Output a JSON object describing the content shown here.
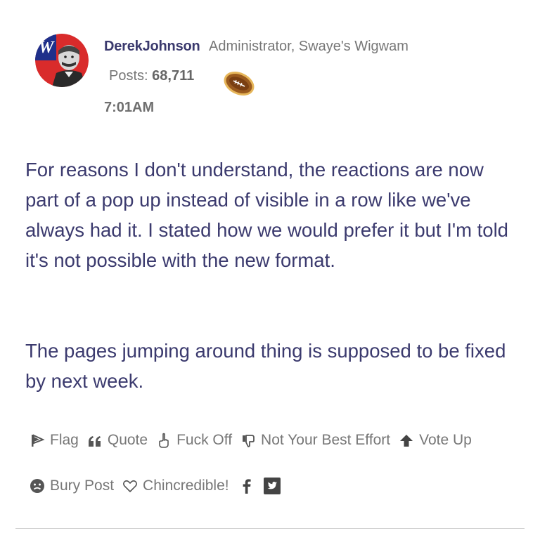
{
  "post": {
    "author": {
      "name": "DerekJohnson",
      "title": "Administrator, Swaye's Wigwam",
      "avatar_icon": "avatar-photo",
      "avatar_logo_letter": "W",
      "posts_label": "Posts:",
      "posts_count": "68,711",
      "rank_icon": "football-icon"
    },
    "timestamp": "7:01AM",
    "body": [
      "For reasons I don't understand, the reactions are now part of a pop up instead of visible in a row like we've always had it. I stated how we would prefer it but I'm told it's not possible with the new format.",
      "The pages jumping around thing is supposed to be fixed by next week."
    ],
    "reactions_row1": [
      {
        "label": "Flag",
        "icon": "flag-icon"
      },
      {
        "label": "Quote",
        "icon": "quote-icon"
      },
      {
        "label": "Fuck Off",
        "icon": "middle-finger-icon"
      },
      {
        "label": "Not Your Best Effort",
        "icon": "thumbs-down-icon"
      },
      {
        "label": "Vote Up",
        "icon": "arrow-up-icon"
      }
    ],
    "reactions_row2": [
      {
        "label": "Bury Post",
        "icon": "bury-face-icon"
      },
      {
        "label": "Chincredible!",
        "icon": "heart-icon"
      }
    ],
    "share": [
      {
        "icon": "facebook-icon"
      },
      {
        "icon": "twitter-icon"
      }
    ]
  },
  "colors": {
    "author": "#3b3a6e",
    "body_text": "#3b3a6e",
    "meta_text": "#777777",
    "divider": "#cfcfcf",
    "background": "#ffffff"
  }
}
